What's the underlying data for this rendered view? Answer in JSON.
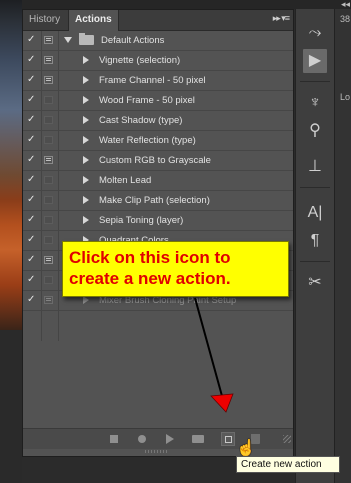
{
  "tabs": {
    "history": "History",
    "actions": "Actions",
    "panel_menu": "▸▸ ▾≡"
  },
  "collapse": "◂◂",
  "actions": [
    {
      "label": "Default Actions",
      "type": "set",
      "checked": true,
      "dialog": true
    },
    {
      "label": "Vignette (selection)",
      "type": "action",
      "checked": true,
      "dialog": true
    },
    {
      "label": "Frame Channel - 50 pixel",
      "type": "action",
      "checked": true,
      "dialog": true
    },
    {
      "label": "Wood Frame - 50 pixel",
      "type": "action",
      "checked": true,
      "dialog": false
    },
    {
      "label": "Cast Shadow (type)",
      "type": "action",
      "checked": true,
      "dialog": false
    },
    {
      "label": "Water Reflection (type)",
      "type": "action",
      "checked": true,
      "dialog": false
    },
    {
      "label": "Custom RGB to Grayscale",
      "type": "action",
      "checked": true,
      "dialog": true
    },
    {
      "label": "Molten Lead",
      "type": "action",
      "checked": true,
      "dialog": false
    },
    {
      "label": "Make Clip Path (selection)",
      "type": "action",
      "checked": true,
      "dialog": false
    },
    {
      "label": "Sepia Toning (layer)",
      "type": "action",
      "checked": true,
      "dialog": false
    },
    {
      "label": "Quadrant Colors",
      "type": "action",
      "checked": true,
      "dialog": false
    },
    {
      "label": "",
      "type": "action",
      "checked": true,
      "dialog": true
    },
    {
      "label": "",
      "type": "action",
      "checked": true,
      "dialog": false
    },
    {
      "label": "Mixer Brush Cloning Paint Setup",
      "type": "action",
      "checked": true,
      "dialog": true
    }
  ],
  "callout": {
    "line1": "Click on this icon to",
    "line2": "create a new action."
  },
  "tooltip": "Create new action",
  "right_panel": {
    "label1": "38",
    "label2": "Lo"
  },
  "toolbar_icons": [
    "stop-icon",
    "record-icon",
    "play-icon",
    "new-set-icon",
    "new-action-icon",
    "trash-icon"
  ],
  "colors": {
    "callout_bg": "#ffff00",
    "callout_text": "#e00000",
    "arrow_head": "#ee0000"
  }
}
